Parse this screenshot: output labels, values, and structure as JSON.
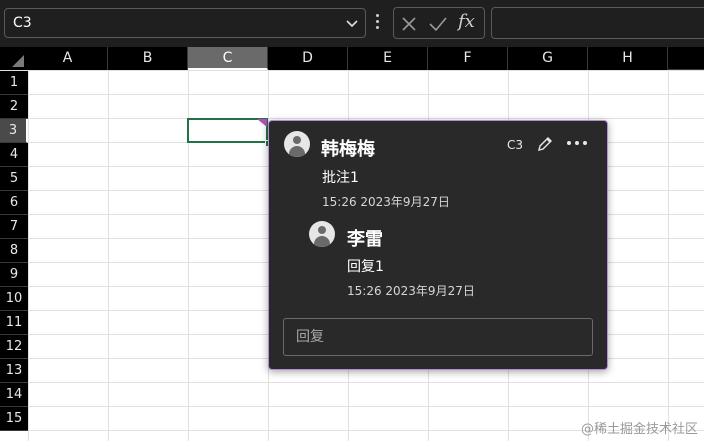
{
  "formula_bar": {
    "name_box": "C3",
    "fx_label": "fx",
    "cancel_icon": "close-icon",
    "enter_icon": "check-icon"
  },
  "columns": [
    "A",
    "B",
    "C",
    "D",
    "E",
    "F",
    "G",
    "H"
  ],
  "rows": [
    "1",
    "2",
    "3",
    "4",
    "5",
    "6",
    "7",
    "8",
    "9",
    "10",
    "11",
    "12",
    "13",
    "14",
    "15"
  ],
  "selected": {
    "column": "C",
    "row": "3"
  },
  "comment": {
    "author": "韩梅梅",
    "cell_ref": "C3",
    "text": "批注1",
    "timestamp": "15:26 2023年9月27日",
    "reply": {
      "author": "李雷",
      "text": "回复1",
      "timestamp": "15:26 2023年9月27日"
    },
    "reply_placeholder": "回复"
  },
  "watermark": "@稀土掘金技术社区",
  "colors": {
    "accent_cell": "#217346",
    "comment_marker": "#b64fb8",
    "card_bg": "#292929",
    "card_border": "#b98ad6"
  }
}
